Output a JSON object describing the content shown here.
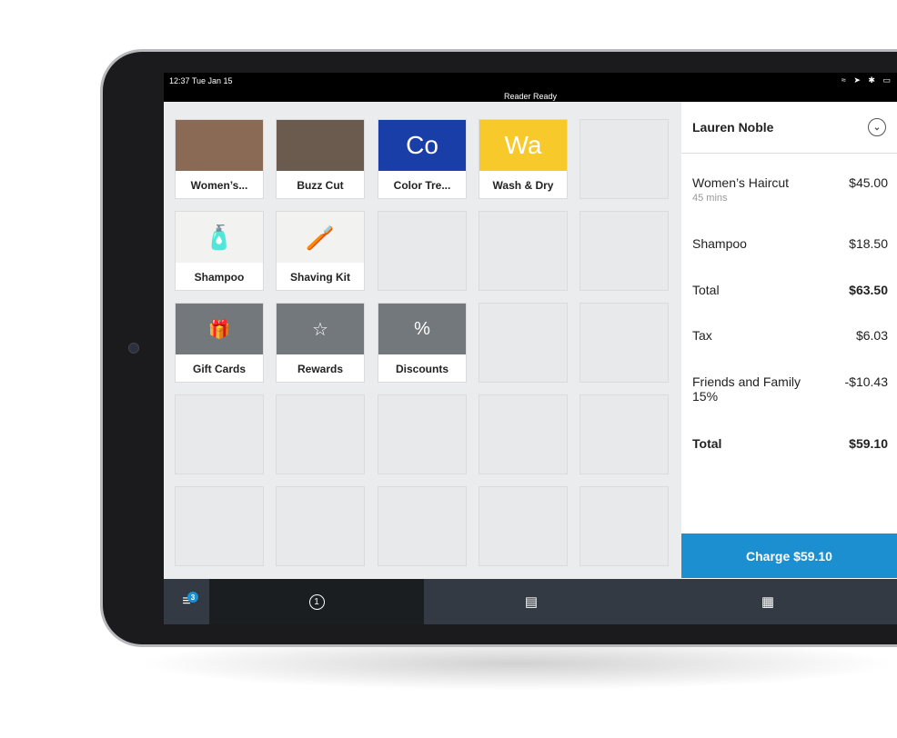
{
  "status": {
    "time": "12:37 Tue Jan 15",
    "reader": "Reader Ready",
    "icons": "wifi location bluetooth battery"
  },
  "tiles": [
    {
      "label": "Women’s...",
      "image": "haircut-photo",
      "bg": "#8a6a55"
    },
    {
      "label": "Buzz Cut",
      "image": "beard-trim-photo",
      "bg": "#6b5a4e"
    },
    {
      "label": "Color Tre...",
      "abbr": "Co",
      "bg": "#1a3ea8"
    },
    {
      "label": "Wash & Dry",
      "abbr": "Wa",
      "bg": "#f8c92b"
    },
    {
      "label": "Shampoo",
      "image": "shampoo-bottle-photo",
      "bg": "#f2f2f0"
    },
    {
      "label": "Shaving Kit",
      "image": "shaving-brush-photo",
      "bg": "#f2f2f0"
    },
    {
      "label": "Gift Cards",
      "image": "gift-card-icon",
      "bg": "#73787c"
    },
    {
      "label": "Rewards",
      "image": "rewards-tag-icon",
      "bg": "#73787c"
    },
    {
      "label": "Discounts",
      "image": "discount-tag-icon",
      "bg": "#73787c"
    }
  ],
  "cart": {
    "customer": "Lauren Noble",
    "lines": [
      {
        "name": "Women’s Haircut",
        "sub": "45 mins",
        "amount": "$45.00"
      },
      {
        "name": "Shampoo",
        "amount": "$18.50"
      },
      {
        "name": "Total",
        "amount": "$63.50"
      },
      {
        "name": "Tax",
        "amount": "$6.03"
      },
      {
        "name": "Friends and Family 15%",
        "amount": "-$10.43"
      },
      {
        "name": "Total",
        "amount": "$59.10"
      }
    ],
    "charge": "Charge $59.10"
  },
  "nav": {
    "badge": "3",
    "tab1": "1"
  },
  "colors": {
    "accent": "#1b8fd0"
  }
}
